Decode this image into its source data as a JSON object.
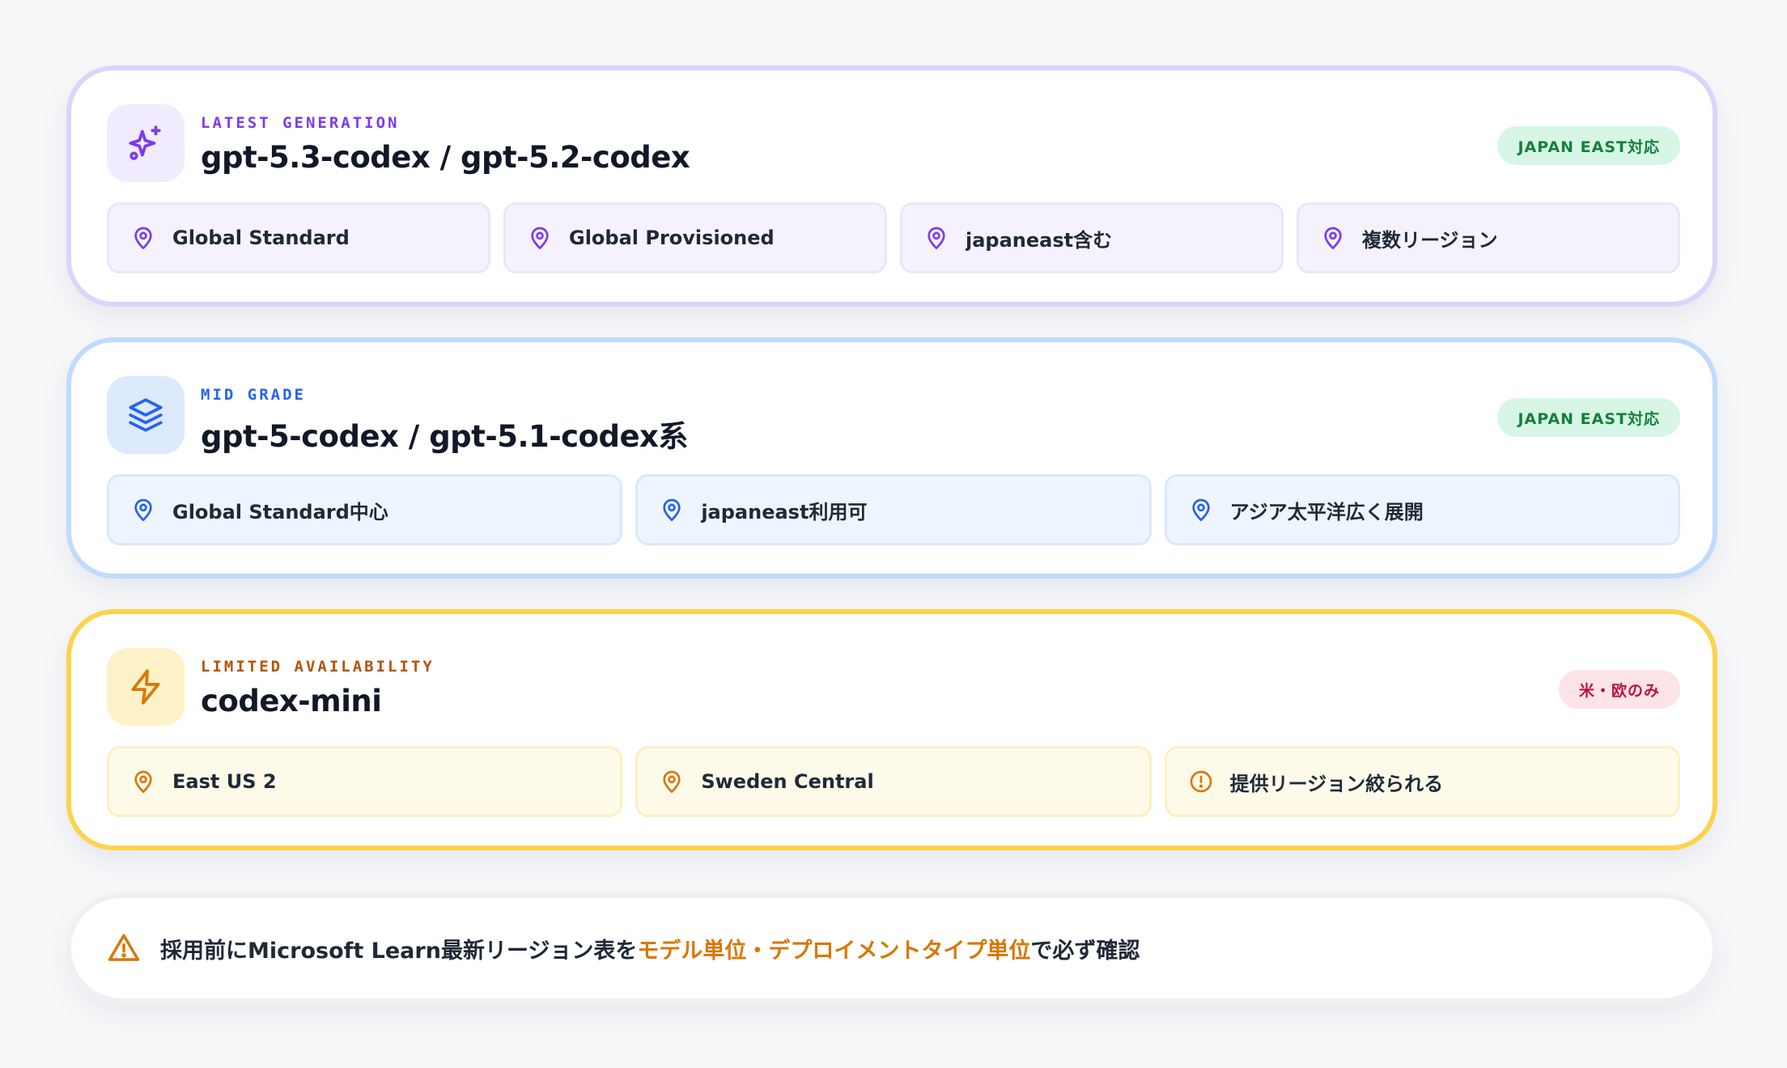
{
  "colors": {
    "purple": "#7c3aed",
    "blue": "#2563eb",
    "amber": "#d97706",
    "green_badge_text": "#15803d",
    "red_badge_text": "#be123c"
  },
  "cards": [
    {
      "eyebrow": "LATEST GENERATION",
      "title": "gpt-5.3-codex / gpt-5.2-codex",
      "icon": "sparkles-icon",
      "badge": "JAPAN EAST対応",
      "chips": [
        {
          "icon": "map-pin-icon",
          "label": "Global Standard"
        },
        {
          "icon": "map-pin-icon",
          "label": "Global Provisioned"
        },
        {
          "icon": "map-pin-icon",
          "label": "japaneast含む"
        },
        {
          "icon": "map-pin-icon",
          "label": "複数リージョン"
        }
      ]
    },
    {
      "eyebrow": "MID GRADE",
      "title": "gpt-5-codex / gpt-5.1-codex系",
      "icon": "layers-icon",
      "badge": "JAPAN EAST対応",
      "chips": [
        {
          "icon": "map-pin-icon",
          "label": "Global Standard中心"
        },
        {
          "icon": "map-pin-icon",
          "label": "japaneast利用可"
        },
        {
          "icon": "map-pin-icon",
          "label": "アジア太平洋広く展開"
        }
      ]
    },
    {
      "eyebrow": "LIMITED AVAILABILITY",
      "title": "codex-mini",
      "icon": "lightning-icon",
      "badge": "米・欧のみ",
      "chips": [
        {
          "icon": "map-pin-icon",
          "label": "East US 2"
        },
        {
          "icon": "map-pin-icon",
          "label": "Sweden Central"
        },
        {
          "icon": "alert-circle-icon",
          "label": "提供リージョン絞られる"
        }
      ]
    }
  ],
  "note": {
    "icon": "warning-triangle-icon",
    "prefix": "採用前にMicrosoft Learn最新リージョン表を",
    "highlight": "モデル単位・デプロイメントタイプ単位",
    "suffix": "で必ず確認"
  }
}
